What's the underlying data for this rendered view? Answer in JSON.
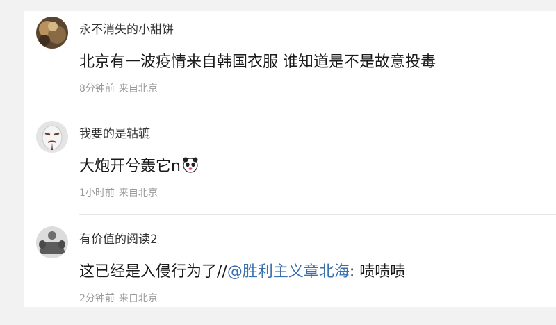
{
  "comments": [
    {
      "username": "永不消失的小甜饼",
      "text": "北京有一波疫情来自韩国衣服 谁知道是不是故意投毒",
      "time": "8分钟前",
      "location": "来自北京",
      "avatar_icon": "cookie-avatar"
    },
    {
      "username": "我要的是轱辘",
      "text": "大炮开兮轰它n",
      "emoji_icon": "panda-face-emoji",
      "time": "1小时前",
      "location": "来自北京",
      "avatar_icon": "mask-face-avatar"
    },
    {
      "username": "有价值的阅读2",
      "text_prefix": "这已经是入侵行为了//",
      "mention": "@胜利主义章北海",
      "text_suffix": ": 啧啧啧",
      "time": "2分钟前",
      "location": "来自北京",
      "avatar_icon": "bodybuilder-avatar"
    }
  ],
  "colors": {
    "background": "#f2f2f2",
    "panel": "#ffffff",
    "mention": "#3a6fb0",
    "meta": "#9a9a9a"
  }
}
